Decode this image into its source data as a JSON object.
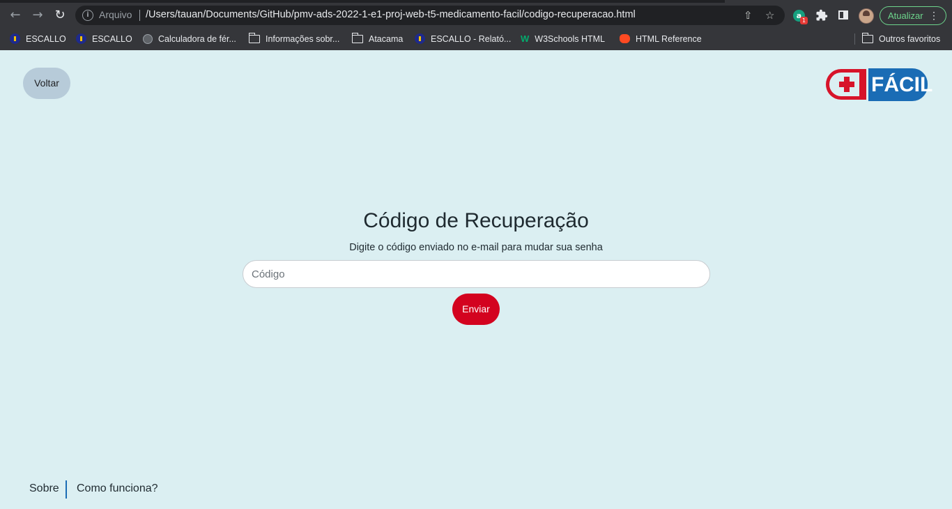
{
  "browser": {
    "address": {
      "scheme_label": "Arquivo",
      "url": "/Users/tauan/Documents/GitHub/pmv-ads-2022-1-e1-proj-web-t5-medicamento-facil/codigo-recuperacao.html"
    },
    "update_label": "Atualizar",
    "extension_badge": "1",
    "bookmarks": [
      {
        "label": "ESCALLO",
        "icon": "escallo-icon"
      },
      {
        "label": "ESCALLO",
        "icon": "escallo-icon"
      },
      {
        "label": "Calculadora de fér...",
        "icon": "globe-icon"
      },
      {
        "label": "Informações sobr...",
        "icon": "folder-icon"
      },
      {
        "label": "Atacama",
        "icon": "folder-icon"
      },
      {
        "label": "ESCALLO - Relató...",
        "icon": "escallo-icon"
      },
      {
        "label": "W3Schools HTML",
        "icon": "w3schools-icon"
      },
      {
        "label": "HTML Reference",
        "icon": "html-reference-icon"
      }
    ],
    "other_bookmarks": "Outros favoritos"
  },
  "page": {
    "back_label": "Voltar",
    "logo_text": "FÁCIL",
    "title": "Código de Recuperação",
    "subtitle": "Digite o código enviado no e-mail para mudar sua senha",
    "code_placeholder": "Código",
    "send_label": "Enviar",
    "footer": {
      "about": "Sobre",
      "how_it_works": "Como funciona?"
    }
  },
  "colors": {
    "page_background": "#dbeff2",
    "primary_red": "#d3031f",
    "brand_blue": "#1a6cb5",
    "back_button": "#b7cbd9"
  }
}
